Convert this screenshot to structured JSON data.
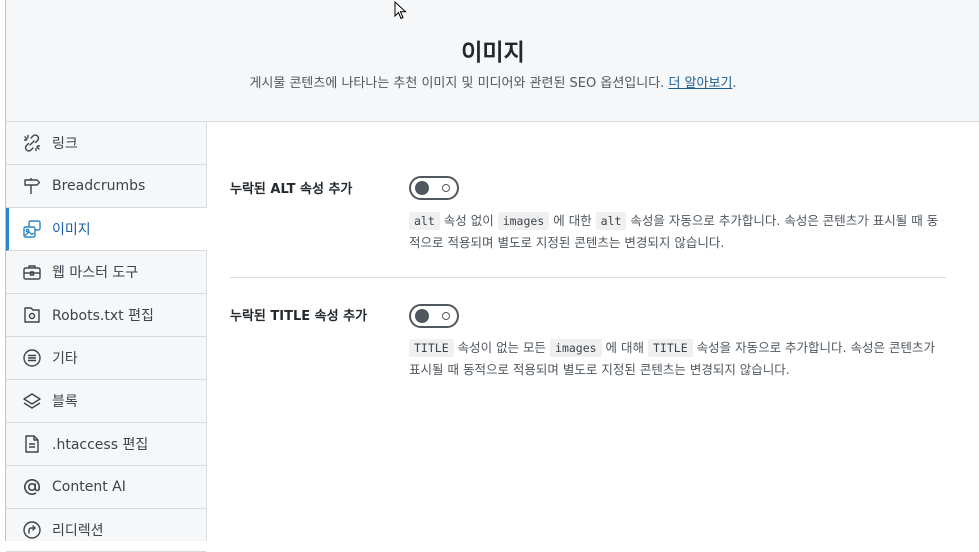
{
  "header": {
    "title": "이미지",
    "description": "게시물 콘텐츠에 나타나는 추천 이미지 및 미디어와 관련된 SEO 옵션입니다.",
    "learn_more": "더 알아보기",
    "period": "."
  },
  "sidebar": {
    "items": [
      {
        "label": "링크",
        "icon": "link-icon"
      },
      {
        "label": "Breadcrumbs",
        "icon": "signpost-icon"
      },
      {
        "label": "이미지",
        "icon": "images-icon",
        "active": true
      },
      {
        "label": "웹 마스터 도구",
        "icon": "toolbox-icon"
      },
      {
        "label": "Robots.txt 편집",
        "icon": "folder-icon"
      },
      {
        "label": "기타",
        "icon": "list-circle-icon"
      },
      {
        "label": "블록",
        "icon": "layers-icon"
      },
      {
        "label": ".htaccess 편집",
        "icon": "file-text-icon"
      },
      {
        "label": "Content AI",
        "icon": "at-icon"
      },
      {
        "label": "리디렉션",
        "icon": "redirect-icon"
      }
    ]
  },
  "settings": [
    {
      "label": "누락된 ALT 속성 추가",
      "enabled": false,
      "help": {
        "code1": "alt",
        "text1": " 속성 없이 ",
        "code2": "images",
        "text2": " 에 대한 ",
        "code3": "alt",
        "text3": " 속성을 자동으로 추가합니다. 속성은 콘텐츠가 표시될 때 동적으로 적용되며 별도로 지정된 콘텐츠는 변경되지 않습니다."
      }
    },
    {
      "label": "누락된 TITLE 속성 추가",
      "enabled": false,
      "help": {
        "code1": "TITLE",
        "text1": " 속성이 없는 모든 ",
        "code2": "images",
        "text2": " 에 대해 ",
        "code3": "TITLE",
        "text3": " 속성을 자동으로 추가합니다. 속성은 콘텐츠가 표시될 때 동적으로 적용되며 별도로 지정된 콘텐츠는 변경되지 않습니다."
      }
    }
  ],
  "colors": {
    "accent": "#2b86c5",
    "active_text": "#1e5ea8",
    "toggle": "#50575e"
  }
}
